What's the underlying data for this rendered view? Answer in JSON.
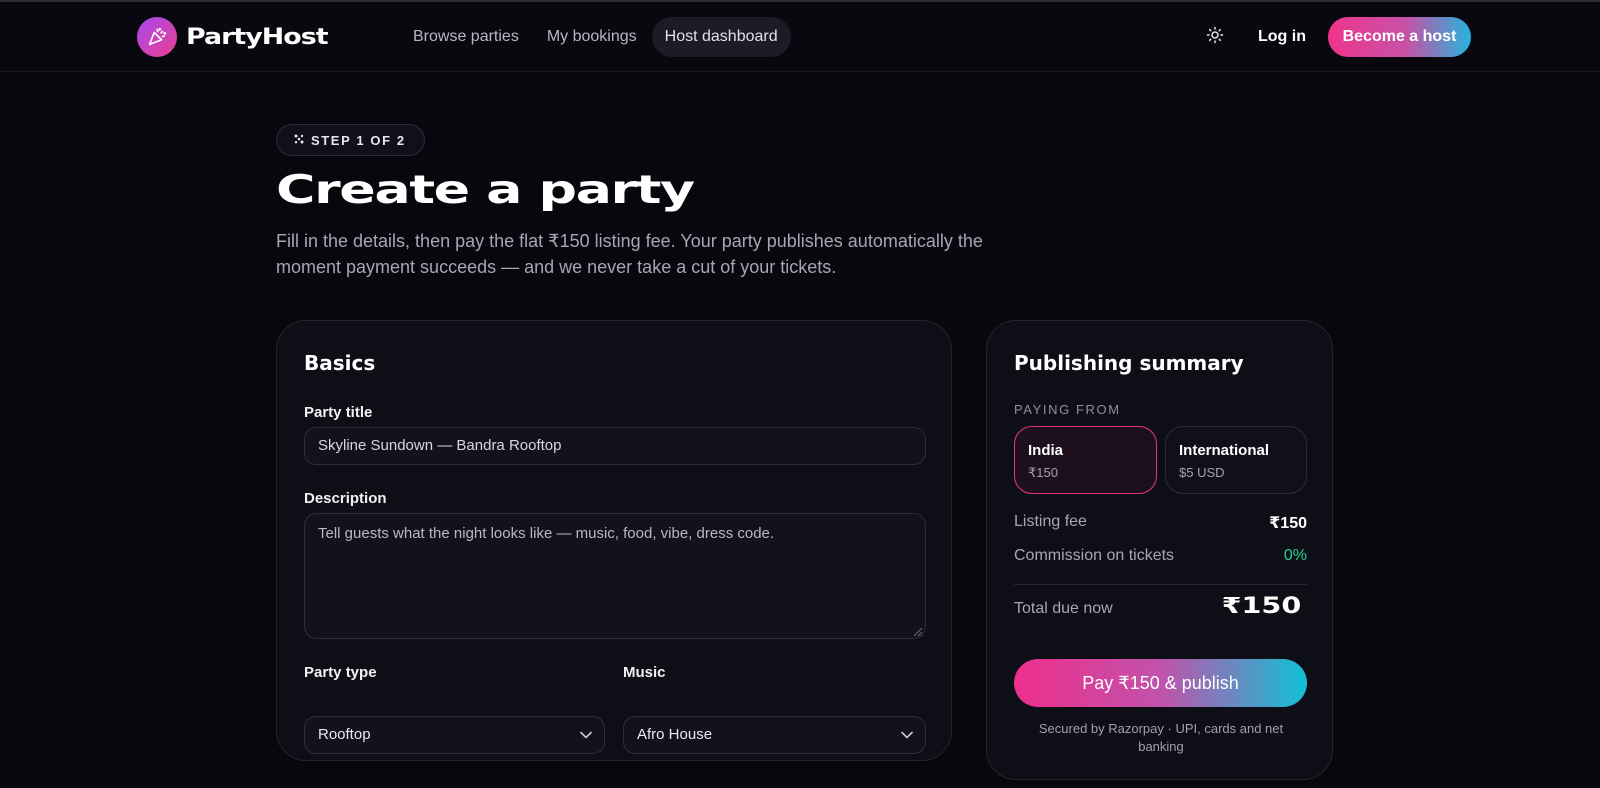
{
  "header": {
    "brand": "PartyHost",
    "nav": [
      "Browse parties",
      "My bookings",
      "Host dashboard"
    ],
    "active_nav": "Host dashboard",
    "login_label": "Log in",
    "become_host_label": "Become a host",
    "theme_icon": "sun-icon"
  },
  "hero": {
    "step_label": "STEP 1 OF 2",
    "title": "Create a party",
    "description": "Fill in the details, then pay the flat ₹150 listing fee. Your party publishes automatically the moment payment succeeds — and we never take a cut of your tickets."
  },
  "basics": {
    "title": "Basics",
    "party_title_label": "Party title",
    "party_title_value": "Skyline Sundown — Bandra Rooftop",
    "description_label": "Description",
    "description_placeholder": "Tell guests what the night looks like — music, food, vibe, dress code.",
    "party_type_label": "Party type",
    "party_type_value": "Rooftop",
    "music_label": "Music",
    "music_value": "Afro House"
  },
  "summary": {
    "title": "Publishing summary",
    "paying_from_label": "PAYING FROM",
    "regions": [
      {
        "name": "India",
        "price": "₹150",
        "selected": true
      },
      {
        "name": "International",
        "price": "$5 USD",
        "selected": false
      }
    ],
    "listing_fee_label": "Listing fee",
    "listing_fee_value": "₹150",
    "commission_label": "Commission on tickets",
    "commission_value": "0%",
    "total_label": "Total due now",
    "total_value": "₹150",
    "pay_button_label": "Pay ₹150 & publish",
    "secure_note": "Secured by Razorpay · UPI, cards and net banking"
  },
  "colors": {
    "accent_pink": "#ec3d8f",
    "accent_cyan": "#14bfd8",
    "success_green": "#2ad38b",
    "background": "#07070d"
  }
}
